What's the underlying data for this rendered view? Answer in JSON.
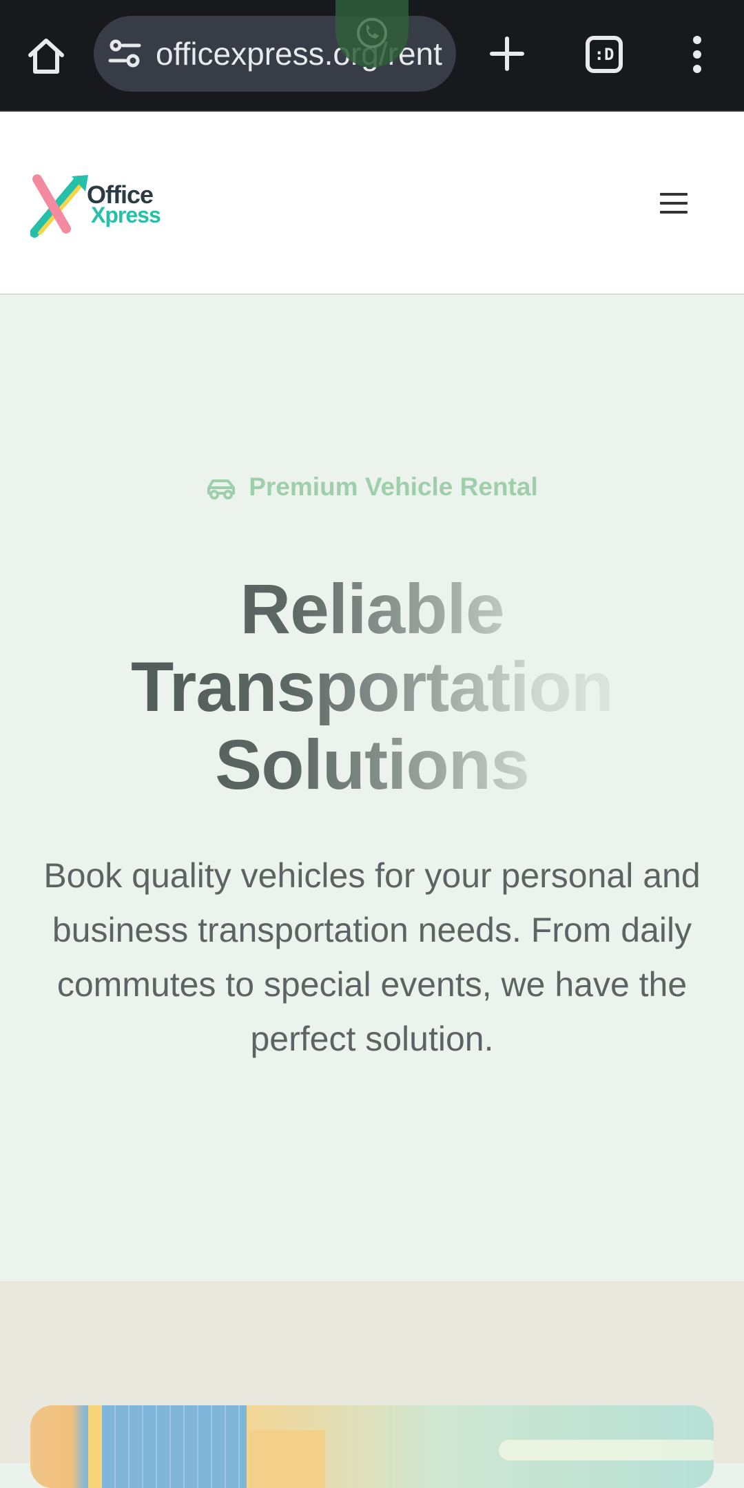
{
  "browser": {
    "url": "officexpress.org/rent",
    "tab_switcher_label": ":D",
    "icons": {
      "home": "home-icon",
      "site_settings": "tune-icon",
      "whatsapp": "whatsapp-icon",
      "new_tab": "plus-icon",
      "tabs": "tabs-icon",
      "menu": "more-vert-icon"
    }
  },
  "header": {
    "logo_line1": "Office",
    "logo_line2": "Xpress",
    "menu_icon": "hamburger-icon",
    "colors": {
      "logo_dark": "#2a3b44",
      "logo_accent": "#26bfa8",
      "logo_pink": "#f48aa0",
      "logo_yellow": "#f5d64a"
    }
  },
  "hero": {
    "eyebrow": "Premium Vehicle Rental",
    "eyebrow_icon": "car-icon",
    "title_line1": "Reliable",
    "title_line2": "Transportation",
    "title_line3": "Solutions",
    "subtitle": "Book quality vehicles for your personal and business transportation needs. From daily commutes to special events, we have the perfect solution.",
    "colors": {
      "background": "#ebf3ec",
      "eyebrow": "#9fcfaa",
      "text": "#5b6462"
    }
  }
}
